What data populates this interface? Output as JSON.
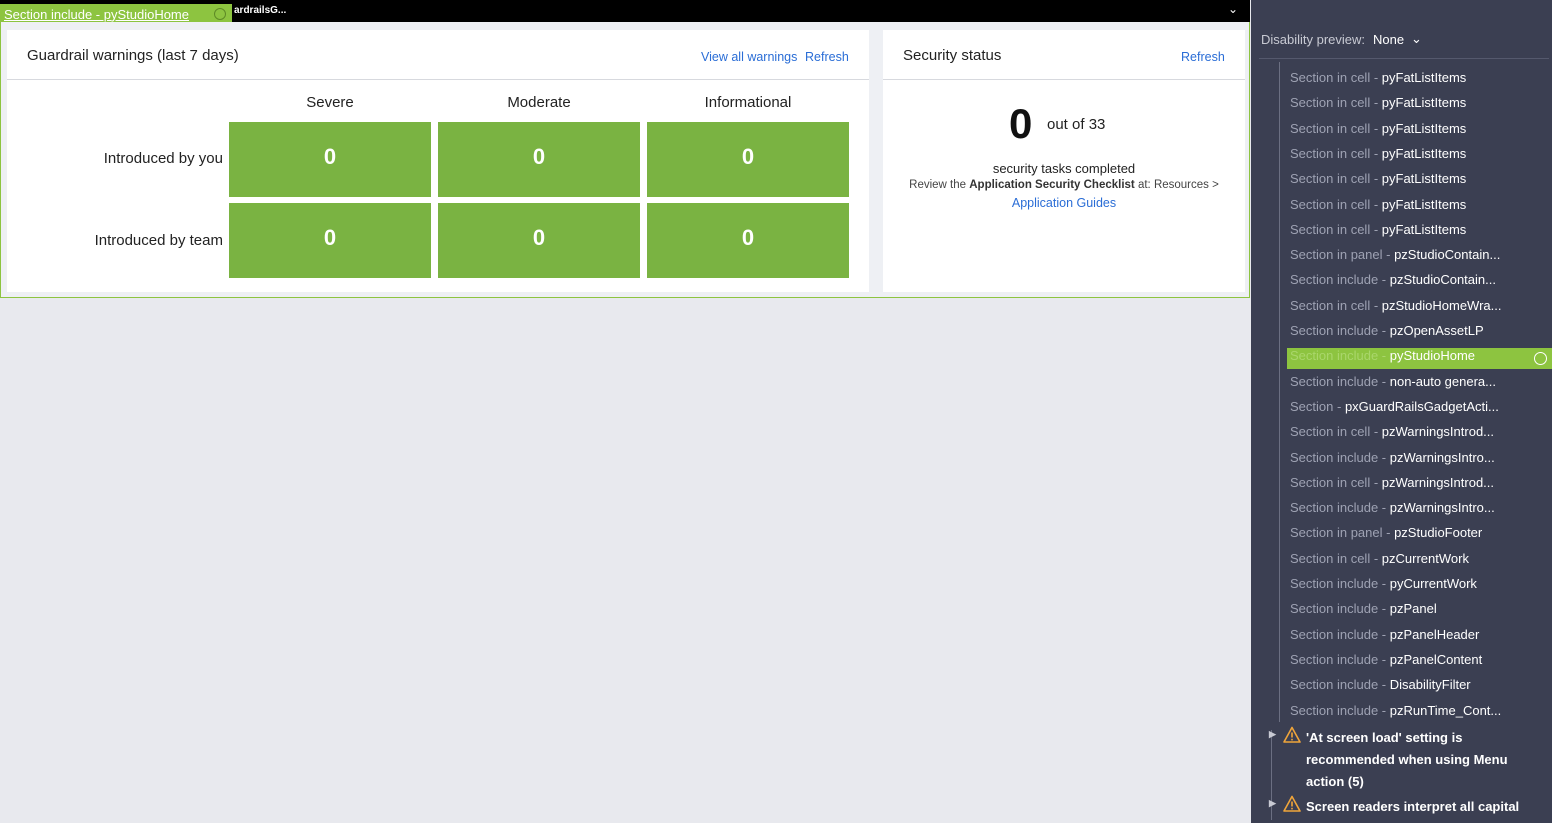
{
  "topbar": {
    "overlay_label": "Section include - pyStudioHome",
    "truncated_label": "ardrailsG..."
  },
  "guardrail": {
    "title": "Guardrail warnings (last 7 days)",
    "view_all_label": "View all warnings",
    "refresh_label": "Refresh",
    "columns": [
      "Severe",
      "Moderate",
      "Informational"
    ],
    "rows": [
      {
        "label": "Introduced by you",
        "values": [
          "0",
          "0",
          "0"
        ]
      },
      {
        "label": "Introduced by team",
        "values": [
          "0",
          "0",
          "0"
        ]
      }
    ]
  },
  "security": {
    "title": "Security status",
    "refresh_label": "Refresh",
    "completed": "0",
    "out_of": "out of 33",
    "tasks_text": "security tasks completed",
    "review_prefix": "Review the ",
    "review_bold": "Application Security Checklist",
    "review_suffix": " at: Resources >",
    "guides_link": "Application Guides"
  },
  "panel": {
    "disability_preview_label": "Disability preview:",
    "disability_preview_value": "None",
    "tree": [
      {
        "kind": "Section in cell",
        "name": "pyFatListItems"
      },
      {
        "kind": "Section in cell",
        "name": "pyFatListItems"
      },
      {
        "kind": "Section in cell",
        "name": "pyFatListItems"
      },
      {
        "kind": "Section in cell",
        "name": "pyFatListItems"
      },
      {
        "kind": "Section in cell",
        "name": "pyFatListItems"
      },
      {
        "kind": "Section in cell",
        "name": "pyFatListItems"
      },
      {
        "kind": "Section in cell",
        "name": "pyFatListItems"
      },
      {
        "kind": "Section in panel",
        "name": "pzStudioContain..."
      },
      {
        "kind": "Section include",
        "name": "pzStudioContain..."
      },
      {
        "kind": "Section in cell",
        "name": "pzStudioHomeWra..."
      },
      {
        "kind": "Section include",
        "name": "pzOpenAssetLP"
      },
      {
        "kind": "Section include",
        "name": "pyStudioHome",
        "selected": true
      },
      {
        "kind": "Section include",
        "name": "non-auto genera..."
      },
      {
        "kind": "Section",
        "name": "pxGuardRailsGadgetActi..."
      },
      {
        "kind": "Section in cell",
        "name": "pzWarningsIntrod..."
      },
      {
        "kind": "Section include",
        "name": "pzWarningsIntro..."
      },
      {
        "kind": "Section in cell",
        "name": "pzWarningsIntrod..."
      },
      {
        "kind": "Section include",
        "name": "pzWarningsIntro..."
      },
      {
        "kind": "Section in panel",
        "name": "pzStudioFooter"
      },
      {
        "kind": "Section in cell",
        "name": "pzCurrentWork"
      },
      {
        "kind": "Section include",
        "name": "pyCurrentWork"
      },
      {
        "kind": "Section include",
        "name": "pzPanel"
      },
      {
        "kind": "Section include",
        "name": "pzPanelHeader"
      },
      {
        "kind": "Section include",
        "name": "pzPanelContent"
      },
      {
        "kind": "Section include",
        "name": "DisabilityFilter"
      },
      {
        "kind": "Section include",
        "name": "pzRunTime_Cont..."
      }
    ],
    "warnings": [
      {
        "text": "'At screen load' setting is recommended when using Menu action (5)"
      },
      {
        "text": "Screen readers interpret all capital"
      }
    ]
  },
  "colors": {
    "tile_green": "#7ab342",
    "highlight_green": "#8dc440",
    "panel_bg": "#3b3f52",
    "link_blue": "#2a6dd6",
    "warning_orange": "#f0a53a"
  }
}
